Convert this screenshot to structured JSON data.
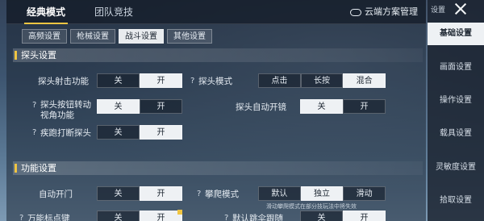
{
  "top_tabs": [
    {
      "label": "经典模式",
      "active": true
    },
    {
      "label": "团队竞技",
      "active": false
    }
  ],
  "cloud_label": "云端方案管理",
  "sub_tabs": [
    {
      "label": "高频设置"
    },
    {
      "label": "枪械设置"
    },
    {
      "label": "战斗设置",
      "active": true
    },
    {
      "label": "其他设置"
    }
  ],
  "sections": {
    "probe": "探头设置",
    "function": "功能设置"
  },
  "settings": {
    "probe_fire": {
      "label": "探头射击功能",
      "options": [
        "关",
        "开"
      ],
      "selected": 1
    },
    "probe_mode": {
      "label": "探头模式",
      "options": [
        "点击",
        "长按",
        "混合"
      ],
      "selected": 2
    },
    "probe_turn": {
      "label": "探头按钮转动视角功能",
      "line1": "探头按钮转动",
      "line2": "视角功能",
      "options": [
        "关",
        "开"
      ],
      "selected": 0
    },
    "probe_scope": {
      "label": "探头自动开镜",
      "options": [
        "关",
        "开"
      ],
      "selected": 0
    },
    "sprint_break": {
      "label": "疾跑打断探头",
      "options": [
        "关",
        "开"
      ],
      "selected": 1
    },
    "auto_door": {
      "label": "自动开门",
      "options": [
        "关",
        "开"
      ],
      "selected": 1
    },
    "climb_mode": {
      "label": "攀爬模式",
      "options": [
        "默认",
        "独立",
        "滑动"
      ],
      "selected": 1
    },
    "universal_mark": {
      "label": "万能标点键",
      "options": [
        "关",
        "开"
      ],
      "selected": 1
    },
    "default_follow": {
      "label": "默认跳伞跟随",
      "options": [
        "关",
        "开"
      ],
      "selected": 1
    }
  },
  "climb_hint": "滑动攀爬模式在部分技玩法中将失效",
  "right_rail": {
    "top_label": "设置",
    "items": [
      {
        "label": "基础设置",
        "active": true
      },
      {
        "label": "画面设置"
      },
      {
        "label": "操作设置"
      },
      {
        "label": "载具设置"
      },
      {
        "label": "灵敏度设置"
      },
      {
        "label": "拾取设置"
      }
    ]
  },
  "colors": {
    "accent": "#f0c542",
    "selected": "#eef1f4"
  }
}
